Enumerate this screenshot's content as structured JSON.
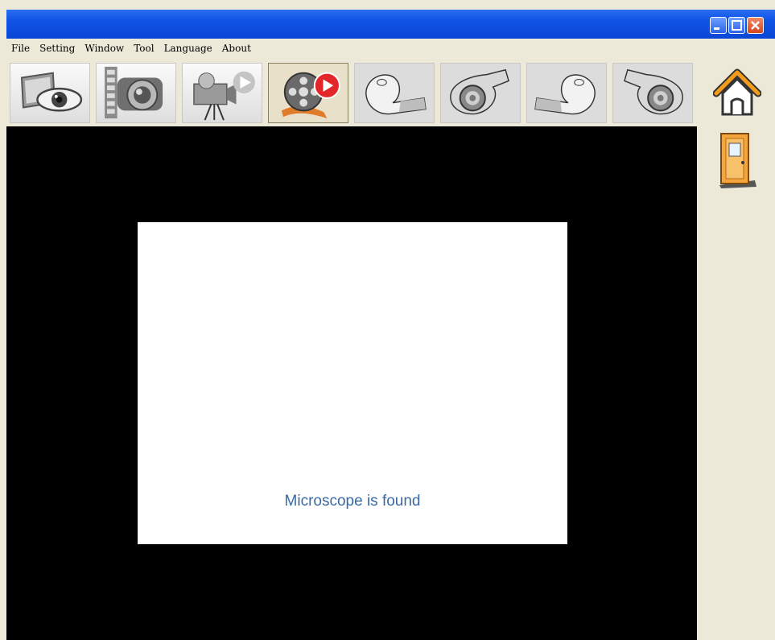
{
  "menu": {
    "items": [
      "File",
      "Setting",
      "Window",
      "Tool",
      "Language",
      "About"
    ]
  },
  "window_controls": [
    "minimize-icon",
    "maximize-icon",
    "close-icon"
  ],
  "toolbar": {
    "buttons": [
      {
        "icon": "monitor-eye-icon",
        "state": "normal"
      },
      {
        "icon": "camera-film-icon",
        "state": "normal"
      },
      {
        "icon": "video-camera-icon",
        "state": "normal"
      },
      {
        "icon": "film-reel-record-icon",
        "state": "active"
      },
      {
        "icon": "hand-open-outline-icon",
        "state": "faded"
      },
      {
        "icon": "hand-grip-lens-icon",
        "state": "faded"
      },
      {
        "icon": "hand-open-mirrored-icon",
        "state": "faded"
      },
      {
        "icon": "hand-grip-lens-mirrored-icon",
        "state": "faded"
      }
    ]
  },
  "side": {
    "buttons": [
      "home-icon",
      "exit-door-icon"
    ]
  },
  "splash": {
    "status_text": "Microscope is found"
  },
  "colors": {
    "title_bar": "#0a46d6",
    "panel_bg": "#ece9d8",
    "video_bg": "#000000",
    "status_text": "#3a6aa6",
    "home_accent": "#f29b1d"
  }
}
